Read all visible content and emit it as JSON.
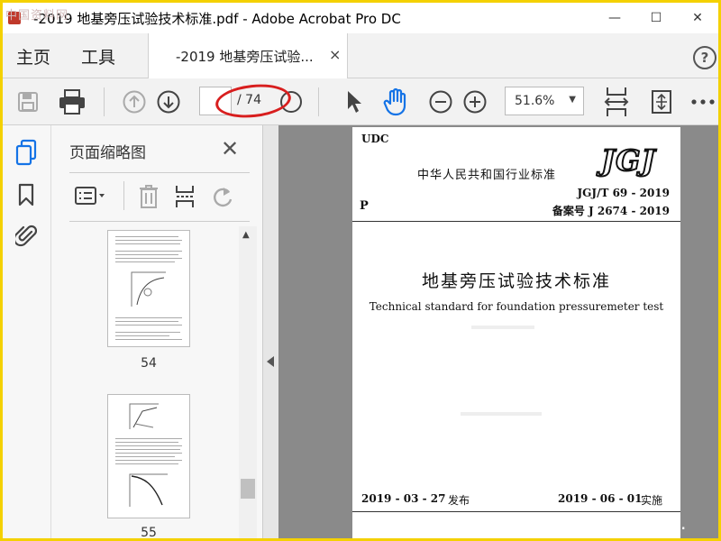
{
  "window": {
    "title": "-2019 地基旁压试验技术标准.pdf - Adobe Acrobat Pro DC",
    "watermark_logo": "中国资料网",
    "controls": {
      "minimize": "—",
      "maximize": "☐",
      "close": "✕"
    }
  },
  "tabs": {
    "home": "主页",
    "tools": "工具",
    "document": "-2019 地基旁压试验...",
    "close": "×",
    "help": "?"
  },
  "toolbar": {
    "current_page": "",
    "total_pages": "/ 74",
    "zoom": "51.6%"
  },
  "panel": {
    "title": "页面缩略图",
    "close": "✕",
    "thumbnails": [
      {
        "label": "54"
      },
      {
        "label": "55"
      }
    ]
  },
  "document": {
    "udc": "UDC",
    "org": "中华人民共和国行业标准",
    "logo": "JGJ",
    "p": "P",
    "code": "JGJ/T 69 - 2019",
    "record": "备案号 J 2674 - 2019",
    "title_cn": "地基旁压试验技术标准",
    "title_en": "Technical standard for foundation pressuremeter test",
    "publish_date": "2019 - 03 - 27",
    "publish_label": "发布",
    "effective_date": "2019 - 06 - 01",
    "effective_label": "实施",
    "site_watermark": "www.cndao."
  },
  "colors": {
    "accent": "#1473e6",
    "frame": "#f4d100",
    "highlight_oval": "#d81e1e",
    "doc_background": "#8a8a8a"
  }
}
